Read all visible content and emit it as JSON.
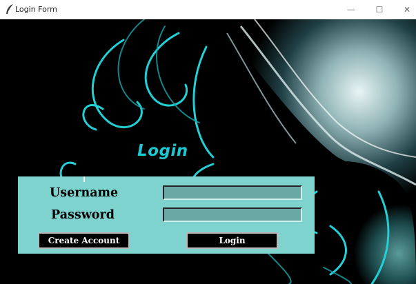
{
  "window": {
    "title": "Login Form",
    "icon": "feather-icon",
    "minimize_glyph": "—",
    "maximize_glyph": "☐",
    "close_glyph": "✕"
  },
  "heading": "Login",
  "form": {
    "username_label": "Username",
    "password_label": "Password",
    "username_value": "",
    "password_value": "",
    "create_account_label": "Create Account",
    "login_label": "Login"
  },
  "colors": {
    "accent": "#1ec8d3",
    "panel": "#7fd3cf",
    "entry": "#6aa8a5",
    "button": "#000000"
  }
}
